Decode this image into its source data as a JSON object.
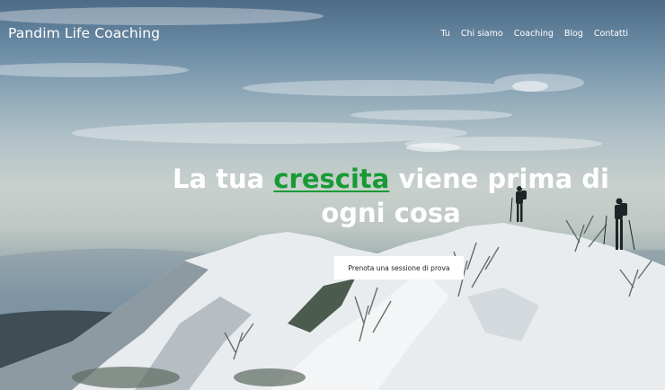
{
  "header": {
    "brand": "Pandim Life Coaching",
    "nav": [
      "Tu",
      "Chi siamo",
      "Coaching",
      "Blog",
      "Contatti"
    ]
  },
  "hero": {
    "headline_before": "La tua ",
    "headline_highlight": "crescita",
    "headline_after": " viene prima di ogni cosa",
    "cta_label": "Prenota una sessione di prova"
  },
  "colors": {
    "highlight": "#189a35",
    "text": "#ffffff",
    "button_bg": "#ffffff",
    "button_text": "#1d1d1d"
  }
}
